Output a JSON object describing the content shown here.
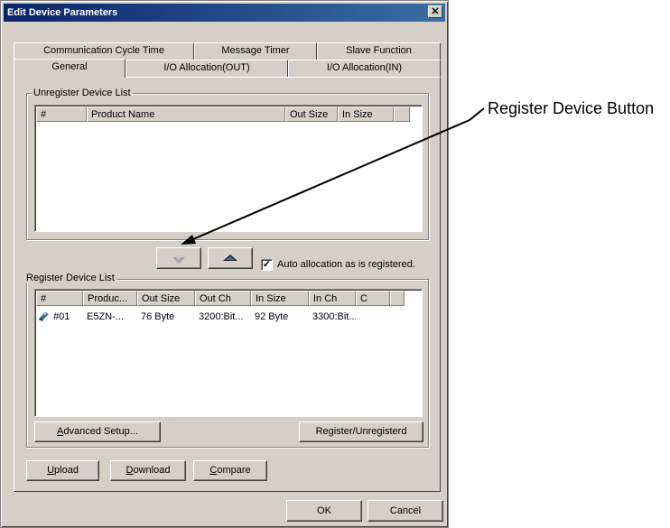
{
  "window": {
    "title": "Edit Device Parameters",
    "close_glyph": "✕"
  },
  "tabs": {
    "row1": [
      "Communication Cycle Time",
      "Message Timer",
      "Slave Function"
    ],
    "row2": [
      "General",
      "I/O Allocation(OUT)",
      "I/O Allocation(IN)"
    ],
    "active": "General"
  },
  "unregister": {
    "label": "Unregister Device List",
    "columns": [
      "#",
      "Product Name",
      "Out Size",
      "In Size",
      ""
    ]
  },
  "register_controls": {
    "up_icon": "arrow-up-icon",
    "down_icon": "arrow-down-icon",
    "auto_alloc_label": "Auto allocation as is registered.",
    "auto_alloc_checked": true
  },
  "registered": {
    "label": "Register Device List",
    "columns": [
      "#",
      "Produc...",
      "Out Size",
      "Out Ch",
      "In Size",
      "In Ch",
      "C",
      ""
    ],
    "rows": [
      {
        "num": "#01",
        "product": "E5ZN-...",
        "out_size": "76 Byte",
        "out_ch": "3200:Bit...",
        "in_size": "92 Byte",
        "in_ch": "3300:Bit...",
        "c": ""
      }
    ]
  },
  "buttons": {
    "advanced_setup": {
      "hot": "A",
      "rest": "dvanced Setup..."
    },
    "register_unregister": "Register/Unregisterd",
    "upload": {
      "hot": "U",
      "rest": "pload"
    },
    "download": {
      "hot": "D",
      "rest": "ownload"
    },
    "compare": {
      "hot": "C",
      "rest": "ompare"
    },
    "ok": "OK",
    "cancel": "Cancel"
  },
  "callout": {
    "text": "Register Device Button"
  }
}
